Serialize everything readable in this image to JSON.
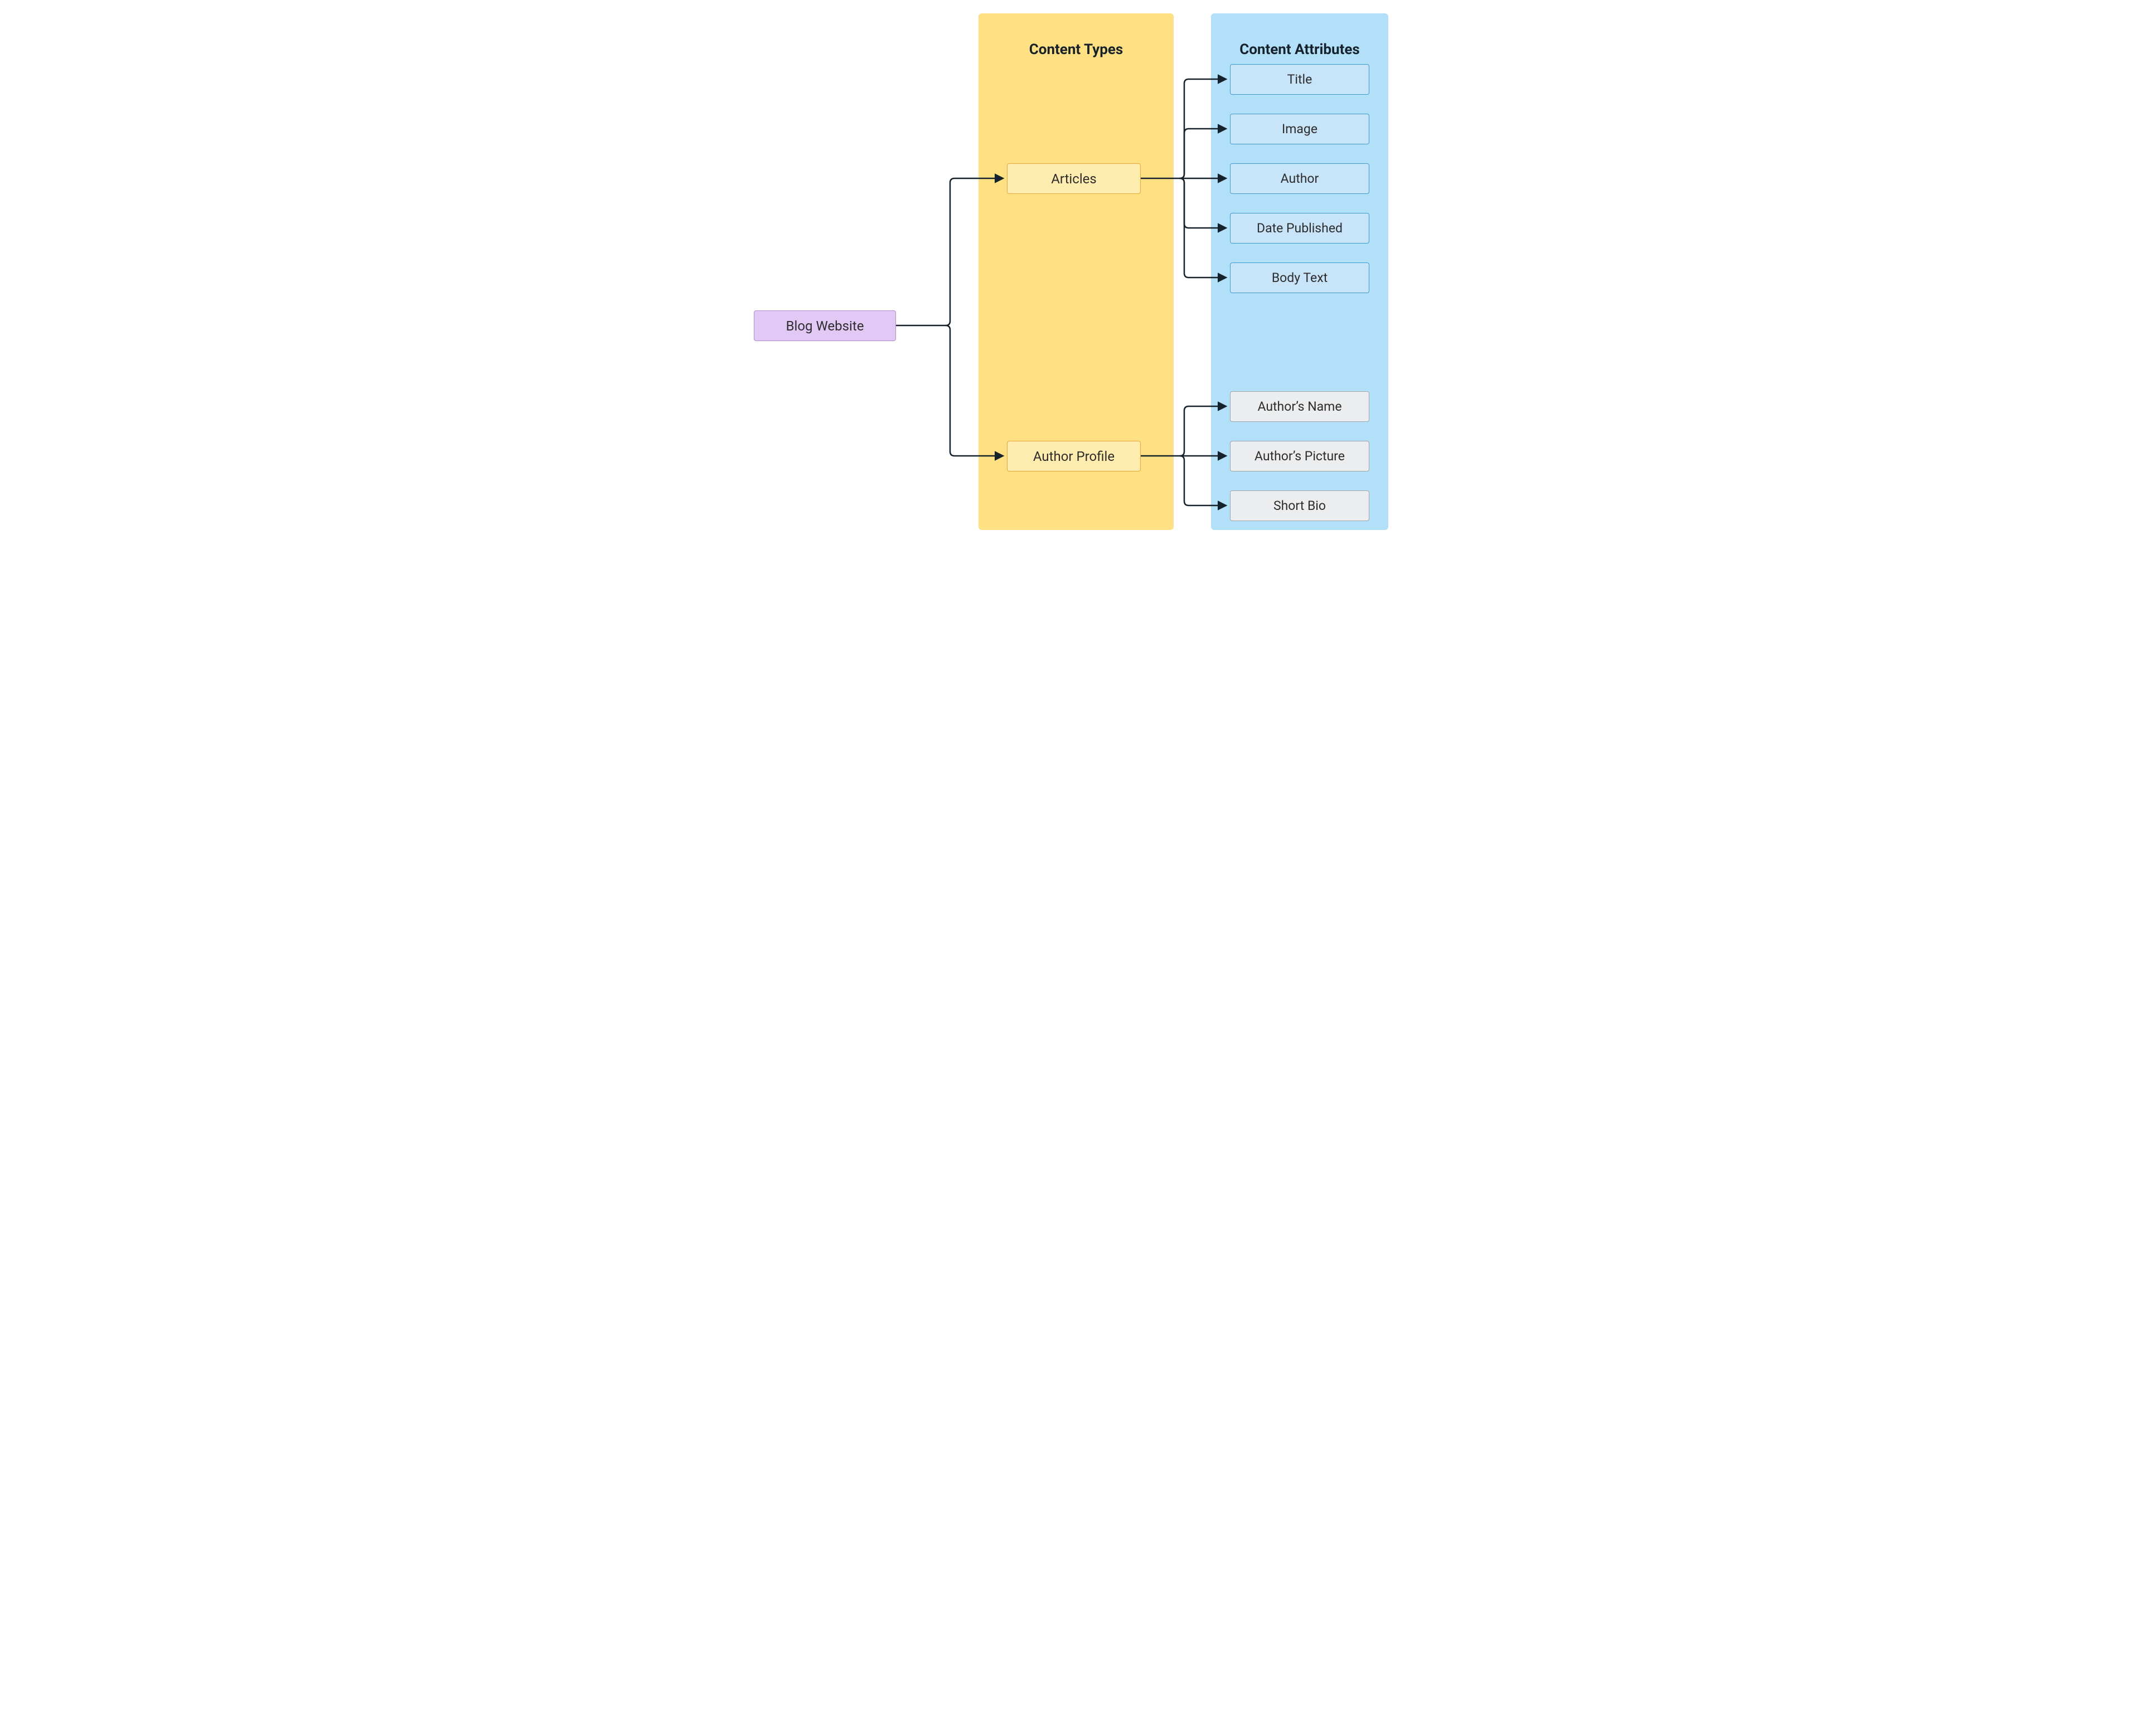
{
  "root": {
    "label": "Blog Website"
  },
  "columns": {
    "types_heading": "Content Types",
    "attrs_heading": "Content Attributes"
  },
  "types": {
    "articles": {
      "label": "Articles"
    },
    "author_profile": {
      "label": "Author Profile"
    }
  },
  "article_attrs": {
    "title": "Title",
    "image": "Image",
    "author": "Author",
    "date_published": "Date Published",
    "body_text": "Body Text"
  },
  "author_attrs": {
    "name": "Author’s Name",
    "picture": "Author’s Picture",
    "bio": "Short Bio"
  },
  "colors": {
    "root_bg": "#e1c8f5",
    "types_band": "#ffe082",
    "type_node_bg": "#ffecae",
    "type_node_border": "#f1a63b",
    "attrs_band": "#b3e0f9",
    "attr_blue_bg": "#c8e4f8",
    "attr_blue_border": "#3d9cd6",
    "attr_grey_bg": "#ecedee",
    "attr_grey_border": "#a0a6ab",
    "connector": "#15222b"
  }
}
